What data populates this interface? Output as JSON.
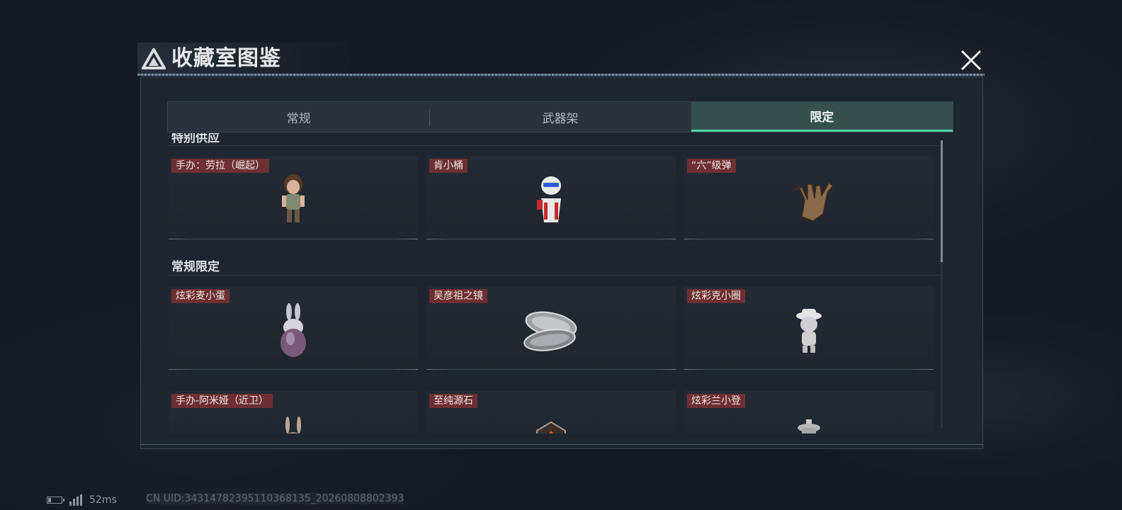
{
  "header": {
    "title": "收藏室图鉴"
  },
  "tabs": [
    {
      "label": "常规",
      "active": false
    },
    {
      "label": "武器架",
      "active": false
    },
    {
      "label": "限定",
      "active": true
    }
  ],
  "sections": [
    {
      "title": "特别供应",
      "items": [
        {
          "label": "手办：劳拉（崛起）",
          "icon": "figure-icon"
        },
        {
          "label": "肯小桶",
          "icon": "bucket-figure-icon"
        },
        {
          "label": "“六”级弹",
          "icon": "hand-gesture-icon"
        }
      ]
    },
    {
      "title": "常规限定",
      "items": [
        {
          "label": "炫彩麦小蛋",
          "icon": "rabbit-egg-icon"
        },
        {
          "label": "吴彦祖之镜",
          "icon": "compact-mirror-icon"
        },
        {
          "label": "炫彩克小圈",
          "icon": "hat-figure-icon"
        },
        {
          "label": "手办-阿米娅（近卫）",
          "icon": "rabbit-figure-icon"
        },
        {
          "label": "至纯源石",
          "icon": "gem-icon"
        },
        {
          "label": "炫彩兰小登",
          "icon": "lamp-figure-icon"
        }
      ]
    }
  ],
  "status": {
    "ping": "52ms",
    "uid": "CN UID:34314782395110368135_20260808802393"
  },
  "colors": {
    "accent": "#4fd1a0",
    "label_bg": "#6d2f33",
    "panel_bg": "#1d252e"
  }
}
